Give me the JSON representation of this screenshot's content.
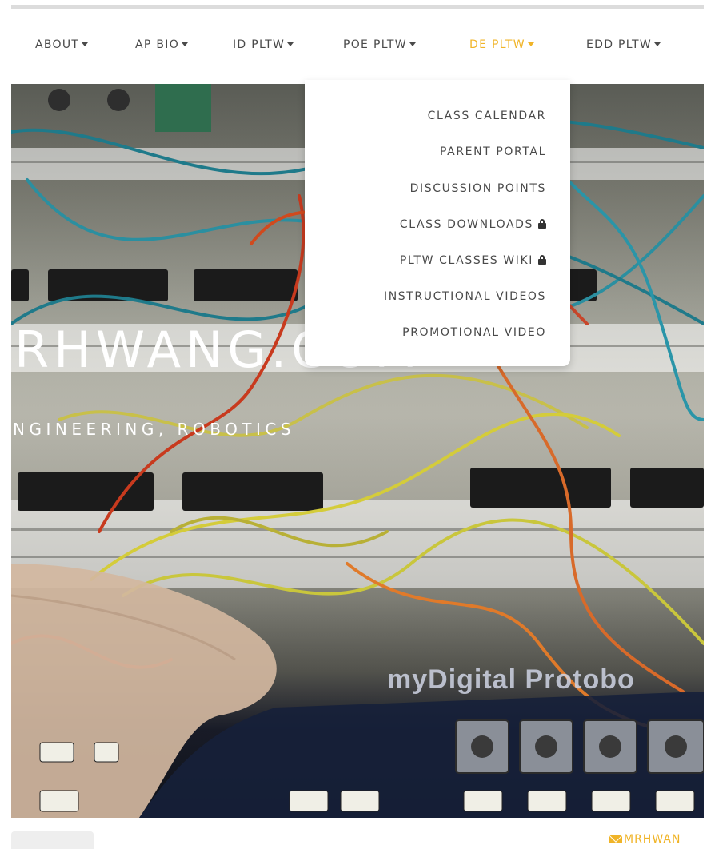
{
  "nav": {
    "items": [
      {
        "label": "ABOUT",
        "active": false
      },
      {
        "label": "AP BIO",
        "active": false
      },
      {
        "label": "ID PLTW",
        "active": false
      },
      {
        "label": "POE PLTW",
        "active": false
      },
      {
        "label": "DE PLTW",
        "active": true
      },
      {
        "label": "EDD PLTW",
        "active": false
      }
    ]
  },
  "dropdown": {
    "items": [
      {
        "label": "CLASS CALENDAR",
        "locked": false
      },
      {
        "label": "PARENT PORTAL",
        "locked": false
      },
      {
        "label": "DISCUSSION POINTS",
        "locked": false
      },
      {
        "label": "CLASS DOWNLOADS",
        "locked": true,
        "icon": "lock-icon"
      },
      {
        "label": "PLTW CLASSES WIKI",
        "locked": true,
        "icon": "lock-icon"
      },
      {
        "label": "INSTRUCTIONAL VIDEOS",
        "locked": false
      },
      {
        "label": "PROMOTIONAL VIDEO",
        "locked": false
      }
    ]
  },
  "hero": {
    "title": "RHWANG.COM",
    "subtitle": "NGINEERING, ROBOTICS",
    "board_label": "myDigital Protobo"
  },
  "footer": {
    "contact_label": "MRHWAN",
    "contact_icon": "envelope-icon"
  },
  "colors": {
    "accent": "#f0b428",
    "nav_text": "#4a4a4a",
    "dropdown_bg": "#ffffff"
  }
}
